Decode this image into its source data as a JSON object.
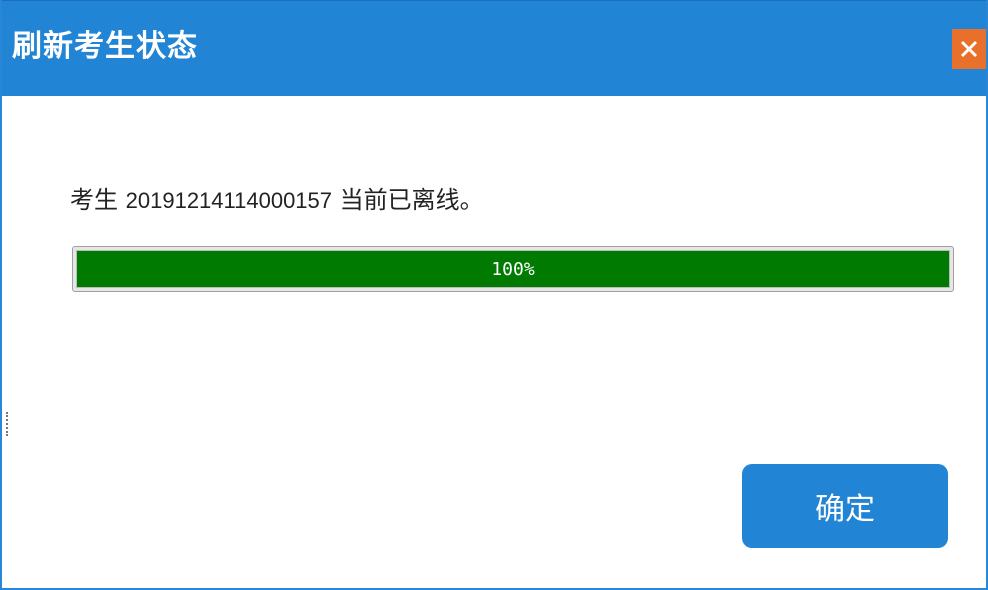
{
  "window": {
    "title": "刷新考生状态",
    "close_icon": "close-icon"
  },
  "message": {
    "prefix": "考生 ",
    "student_id": "20191214114000157",
    "suffix": " 当前已离线。"
  },
  "progress": {
    "value": 1.0,
    "label": "100%",
    "fill_color": "#007a00"
  },
  "buttons": {
    "confirm_label": "确定"
  },
  "colors": {
    "accent": "#2284d4",
    "close": "#e8702a"
  }
}
